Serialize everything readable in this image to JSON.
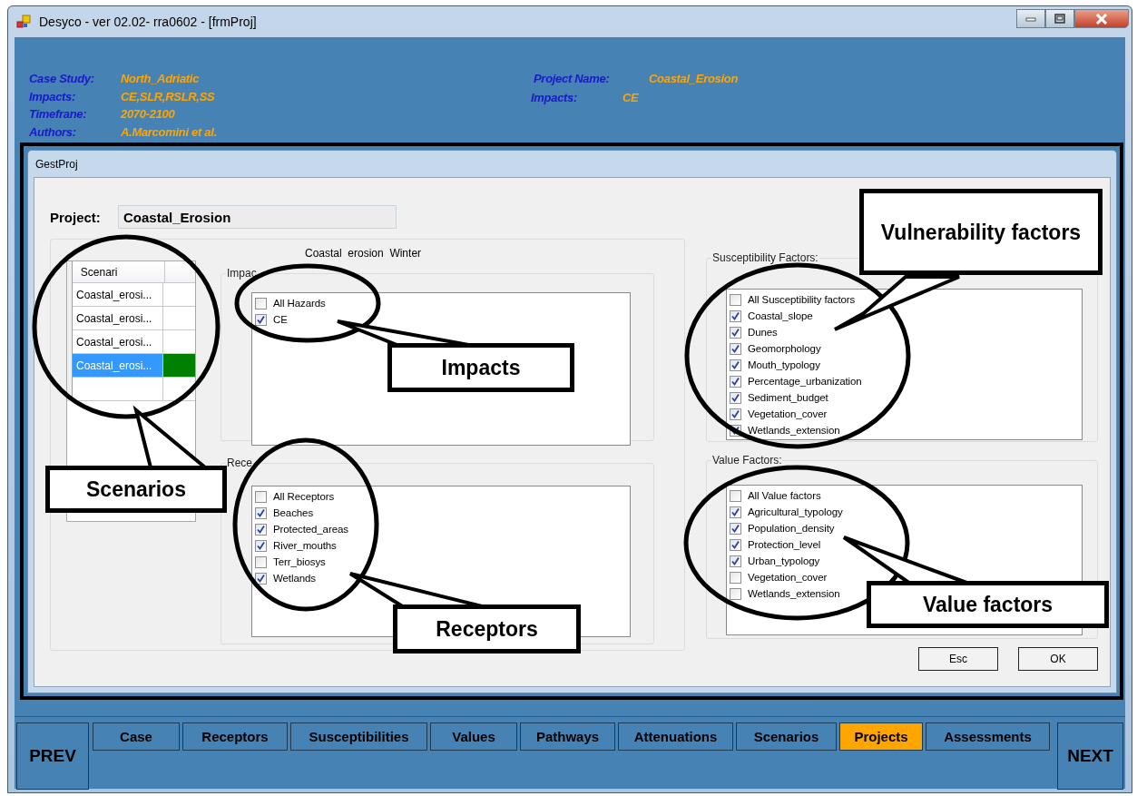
{
  "window": {
    "title": "Desyco - ver 02.02- rra0602 - [frmProj]"
  },
  "header": {
    "left": [
      {
        "label": "Case Study:",
        "value": "North_Adriatic"
      },
      {
        "label": "Impacts:",
        "value": "CE,SLR,RSLR,SS"
      },
      {
        "label": "Timefrane:",
        "value": "2070-2100"
      },
      {
        "label": "Authors:",
        "value": "A.Marcomini et al."
      }
    ],
    "right": [
      {
        "label": "Project Name:",
        "value": "Coastal_Erosion"
      },
      {
        "label": "Impacts:",
        "value": "CE"
      }
    ]
  },
  "dialog": {
    "title": "GestProj",
    "project_label": "Project:",
    "project_value": "Coastal_Erosion",
    "scenario_grid": {
      "column": "Scenari",
      "rows": [
        {
          "name": "Coastal_erosi...",
          "selected": false,
          "color": "#ffffff"
        },
        {
          "name": "Coastal_erosi...",
          "selected": false,
          "color": "#ffffff"
        },
        {
          "name": "Coastal_erosi...",
          "selected": false,
          "color": "#ffffff"
        },
        {
          "name": "Coastal_erosi...",
          "selected": true,
          "color": "#008000"
        }
      ]
    },
    "scenario_title": "Coastal  erosion  Winter",
    "groups": [
      {
        "legend": "Impac",
        "items": [
          {
            "label": "All Hazards",
            "checked": false
          },
          {
            "label": "CE",
            "checked": true
          }
        ]
      },
      {
        "legend": "Rece",
        "items": [
          {
            "label": "All Receptors",
            "checked": false
          },
          {
            "label": "Beaches",
            "checked": true
          },
          {
            "label": "Protected_areas",
            "checked": true
          },
          {
            "label": "River_mouths",
            "checked": true
          },
          {
            "label": "Terr_biosys",
            "checked": false
          },
          {
            "label": "Wetlands",
            "checked": true
          }
        ]
      },
      {
        "legend": "Susceptibility Factors:",
        "items": [
          {
            "label": "All Susceptibility factors",
            "checked": false
          },
          {
            "label": "Coastal_slope",
            "checked": true
          },
          {
            "label": "Dunes",
            "checked": true
          },
          {
            "label": "Geomorphology",
            "checked": true
          },
          {
            "label": "Mouth_typology",
            "checked": true
          },
          {
            "label": "Percentage_urbanization",
            "checked": true
          },
          {
            "label": "Sediment_budget",
            "checked": true
          },
          {
            "label": "Vegetation_cover",
            "checked": true
          },
          {
            "label": "Wetlands_extension",
            "checked": true
          }
        ]
      },
      {
        "legend": "Value Factors:",
        "items": [
          {
            "label": "All Value factors",
            "checked": false
          },
          {
            "label": "Agricultural_typology",
            "checked": true
          },
          {
            "label": "Population_density",
            "checked": true
          },
          {
            "label": "Protection_level",
            "checked": true
          },
          {
            "label": "Urban_typology",
            "checked": true
          },
          {
            "label": "Vegetation_cover",
            "checked": false
          },
          {
            "label": "Wetlands_extension",
            "checked": false
          }
        ]
      }
    ],
    "buttons": [
      "Esc",
      "OK"
    ]
  },
  "nav": {
    "prev": "PREV",
    "next": "NEXT",
    "tabs": [
      {
        "label": "Case",
        "selected": false
      },
      {
        "label": "Receptors",
        "selected": false
      },
      {
        "label": "Susceptibilities",
        "selected": false
      },
      {
        "label": "Values",
        "selected": false
      },
      {
        "label": "Pathways",
        "selected": false
      },
      {
        "label": "Attenuations",
        "selected": false
      },
      {
        "label": "Scenarios",
        "selected": false
      },
      {
        "label": "Projects",
        "selected": true
      },
      {
        "label": "Assessments",
        "selected": false
      }
    ]
  },
  "callouts": [
    "Scenarios",
    "Impacts",
    "Receptors",
    "Vulnerability factors",
    "Value factors"
  ]
}
